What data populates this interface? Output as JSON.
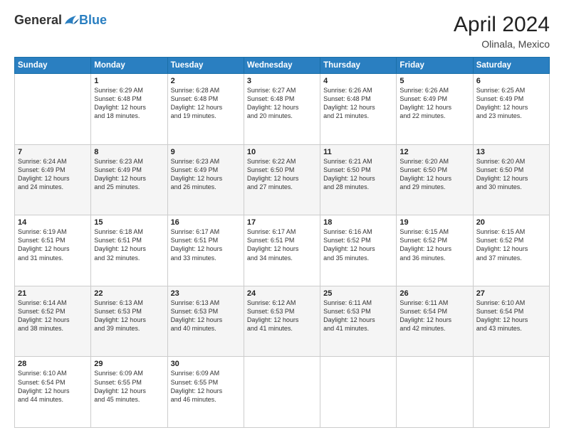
{
  "header": {
    "logo_general": "General",
    "logo_blue": "Blue",
    "month_year": "April 2024",
    "location": "Olinala, Mexico"
  },
  "days_of_week": [
    "Sunday",
    "Monday",
    "Tuesday",
    "Wednesday",
    "Thursday",
    "Friday",
    "Saturday"
  ],
  "weeks": [
    [
      {
        "day": "",
        "info": ""
      },
      {
        "day": "1",
        "info": "Sunrise: 6:29 AM\nSunset: 6:48 PM\nDaylight: 12 hours\nand 18 minutes."
      },
      {
        "day": "2",
        "info": "Sunrise: 6:28 AM\nSunset: 6:48 PM\nDaylight: 12 hours\nand 19 minutes."
      },
      {
        "day": "3",
        "info": "Sunrise: 6:27 AM\nSunset: 6:48 PM\nDaylight: 12 hours\nand 20 minutes."
      },
      {
        "day": "4",
        "info": "Sunrise: 6:26 AM\nSunset: 6:48 PM\nDaylight: 12 hours\nand 21 minutes."
      },
      {
        "day": "5",
        "info": "Sunrise: 6:26 AM\nSunset: 6:49 PM\nDaylight: 12 hours\nand 22 minutes."
      },
      {
        "day": "6",
        "info": "Sunrise: 6:25 AM\nSunset: 6:49 PM\nDaylight: 12 hours\nand 23 minutes."
      }
    ],
    [
      {
        "day": "7",
        "info": "Sunrise: 6:24 AM\nSunset: 6:49 PM\nDaylight: 12 hours\nand 24 minutes."
      },
      {
        "day": "8",
        "info": "Sunrise: 6:23 AM\nSunset: 6:49 PM\nDaylight: 12 hours\nand 25 minutes."
      },
      {
        "day": "9",
        "info": "Sunrise: 6:23 AM\nSunset: 6:49 PM\nDaylight: 12 hours\nand 26 minutes."
      },
      {
        "day": "10",
        "info": "Sunrise: 6:22 AM\nSunset: 6:50 PM\nDaylight: 12 hours\nand 27 minutes."
      },
      {
        "day": "11",
        "info": "Sunrise: 6:21 AM\nSunset: 6:50 PM\nDaylight: 12 hours\nand 28 minutes."
      },
      {
        "day": "12",
        "info": "Sunrise: 6:20 AM\nSunset: 6:50 PM\nDaylight: 12 hours\nand 29 minutes."
      },
      {
        "day": "13",
        "info": "Sunrise: 6:20 AM\nSunset: 6:50 PM\nDaylight: 12 hours\nand 30 minutes."
      }
    ],
    [
      {
        "day": "14",
        "info": "Sunrise: 6:19 AM\nSunset: 6:51 PM\nDaylight: 12 hours\nand 31 minutes."
      },
      {
        "day": "15",
        "info": "Sunrise: 6:18 AM\nSunset: 6:51 PM\nDaylight: 12 hours\nand 32 minutes."
      },
      {
        "day": "16",
        "info": "Sunrise: 6:17 AM\nSunset: 6:51 PM\nDaylight: 12 hours\nand 33 minutes."
      },
      {
        "day": "17",
        "info": "Sunrise: 6:17 AM\nSunset: 6:51 PM\nDaylight: 12 hours\nand 34 minutes."
      },
      {
        "day": "18",
        "info": "Sunrise: 6:16 AM\nSunset: 6:52 PM\nDaylight: 12 hours\nand 35 minutes."
      },
      {
        "day": "19",
        "info": "Sunrise: 6:15 AM\nSunset: 6:52 PM\nDaylight: 12 hours\nand 36 minutes."
      },
      {
        "day": "20",
        "info": "Sunrise: 6:15 AM\nSunset: 6:52 PM\nDaylight: 12 hours\nand 37 minutes."
      }
    ],
    [
      {
        "day": "21",
        "info": "Sunrise: 6:14 AM\nSunset: 6:52 PM\nDaylight: 12 hours\nand 38 minutes."
      },
      {
        "day": "22",
        "info": "Sunrise: 6:13 AM\nSunset: 6:53 PM\nDaylight: 12 hours\nand 39 minutes."
      },
      {
        "day": "23",
        "info": "Sunrise: 6:13 AM\nSunset: 6:53 PM\nDaylight: 12 hours\nand 40 minutes."
      },
      {
        "day": "24",
        "info": "Sunrise: 6:12 AM\nSunset: 6:53 PM\nDaylight: 12 hours\nand 41 minutes."
      },
      {
        "day": "25",
        "info": "Sunrise: 6:11 AM\nSunset: 6:53 PM\nDaylight: 12 hours\nand 41 minutes."
      },
      {
        "day": "26",
        "info": "Sunrise: 6:11 AM\nSunset: 6:54 PM\nDaylight: 12 hours\nand 42 minutes."
      },
      {
        "day": "27",
        "info": "Sunrise: 6:10 AM\nSunset: 6:54 PM\nDaylight: 12 hours\nand 43 minutes."
      }
    ],
    [
      {
        "day": "28",
        "info": "Sunrise: 6:10 AM\nSunset: 6:54 PM\nDaylight: 12 hours\nand 44 minutes."
      },
      {
        "day": "29",
        "info": "Sunrise: 6:09 AM\nSunset: 6:55 PM\nDaylight: 12 hours\nand 45 minutes."
      },
      {
        "day": "30",
        "info": "Sunrise: 6:09 AM\nSunset: 6:55 PM\nDaylight: 12 hours\nand 46 minutes."
      },
      {
        "day": "",
        "info": ""
      },
      {
        "day": "",
        "info": ""
      },
      {
        "day": "",
        "info": ""
      },
      {
        "day": "",
        "info": ""
      }
    ]
  ]
}
